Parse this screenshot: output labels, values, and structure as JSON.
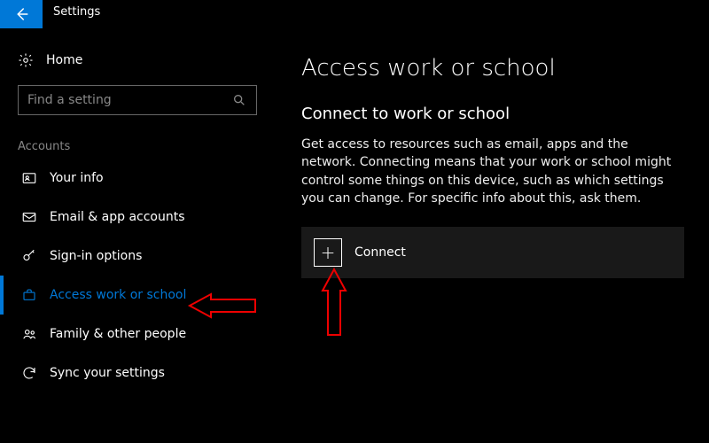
{
  "titlebar": {
    "title": "Settings"
  },
  "sidebar": {
    "home_label": "Home",
    "search_placeholder": "Find a setting",
    "section_label": "Accounts",
    "items": [
      {
        "label": "Your info"
      },
      {
        "label": "Email & app accounts"
      },
      {
        "label": "Sign-in options"
      },
      {
        "label": "Access work or school"
      },
      {
        "label": "Family & other people"
      },
      {
        "label": "Sync your settings"
      }
    ]
  },
  "main": {
    "heading": "Access work or school",
    "subheading": "Connect to work or school",
    "description": "Get access to resources such as email, apps and the network. Connecting means that your work or school might control some things on this device, such as which settings you can change. For specific info about this, ask them.",
    "connect_label": "Connect",
    "plus_glyph": "+"
  }
}
